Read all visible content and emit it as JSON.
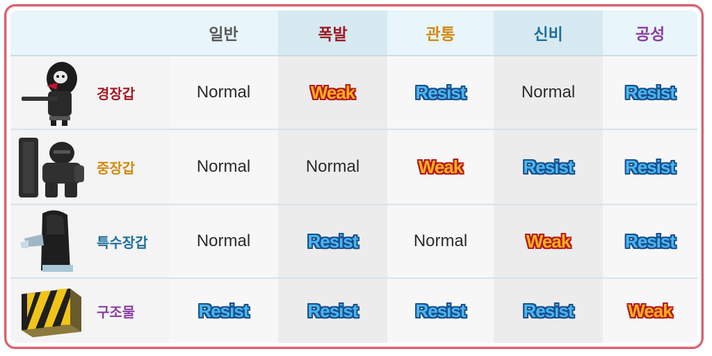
{
  "header": {
    "columns": [
      {
        "label": "일반",
        "color": "#5a5a5a"
      },
      {
        "label": "폭발",
        "color": "#9b1b22"
      },
      {
        "label": "관통",
        "color": "#d18a12"
      },
      {
        "label": "신비",
        "color": "#1f6f9e"
      },
      {
        "label": "공성",
        "color": "#8a3fa0"
      }
    ]
  },
  "rows": [
    {
      "armor": "경장갑",
      "color": "#a11a24",
      "icon": "light-armor-unit-icon",
      "values": [
        "Normal",
        "Weak",
        "Resist",
        "Normal",
        "Resist"
      ]
    },
    {
      "armor": "중장갑",
      "color": "#d18a12",
      "icon": "heavy-armor-unit-icon",
      "values": [
        "Normal",
        "Normal",
        "Weak",
        "Resist",
        "Resist"
      ]
    },
    {
      "armor": "특수장갑",
      "color": "#1f6f9e",
      "icon": "special-armor-unit-icon",
      "values": [
        "Normal",
        "Resist",
        "Normal",
        "Weak",
        "Resist"
      ]
    },
    {
      "armor": "구조물",
      "color": "#8a3fa0",
      "icon": "structure-barricade-icon",
      "values": [
        "Resist",
        "Resist",
        "Resist",
        "Resist",
        "Weak"
      ]
    }
  ]
}
